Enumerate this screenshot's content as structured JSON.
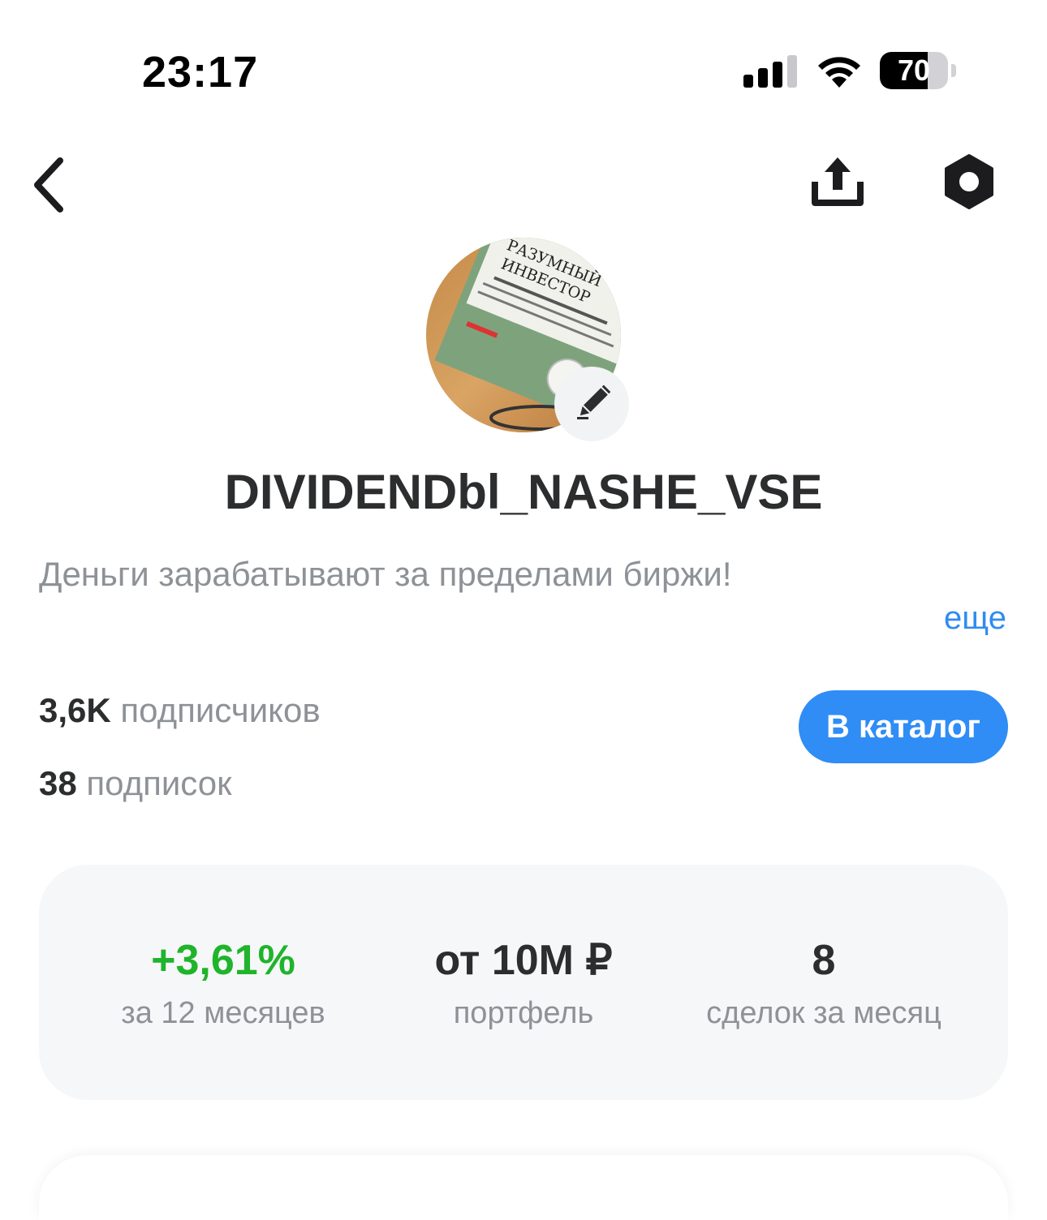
{
  "status_bar": {
    "time": "23:17",
    "battery_level": 70,
    "battery_text": "70",
    "signal_bars": 3
  },
  "nav": {
    "back_icon": "chevron-left-icon",
    "share_icon": "share-upload-icon",
    "settings_icon": "hexagon-settings-icon"
  },
  "profile": {
    "username": "DIVIDENDbl_NASHE_VSE",
    "bio": "Деньги зарабатывают за пределами биржи!",
    "more_label": "еще",
    "followers_count": "3,6K",
    "followers_label": "подписчиков",
    "following_count": "38",
    "following_label": "подписок",
    "catalog_button": "В каталог",
    "avatar_book_title": "РАЗУМНЫЙ ИНВЕСТОР"
  },
  "stats": [
    {
      "value": "+3,61%",
      "label": "за 12 месяцев",
      "color": "#1fb42b"
    },
    {
      "value": "от 10M ₽",
      "label": "портфель",
      "color": "#2c2d2e"
    },
    {
      "value": "8",
      "label": "сделок за месяц",
      "color": "#2c2d2e"
    }
  ],
  "colors": {
    "accent": "#2f8df5",
    "positive": "#1fb42b",
    "muted_text": "#8e9297",
    "card_bg": "#f6f7f8"
  }
}
